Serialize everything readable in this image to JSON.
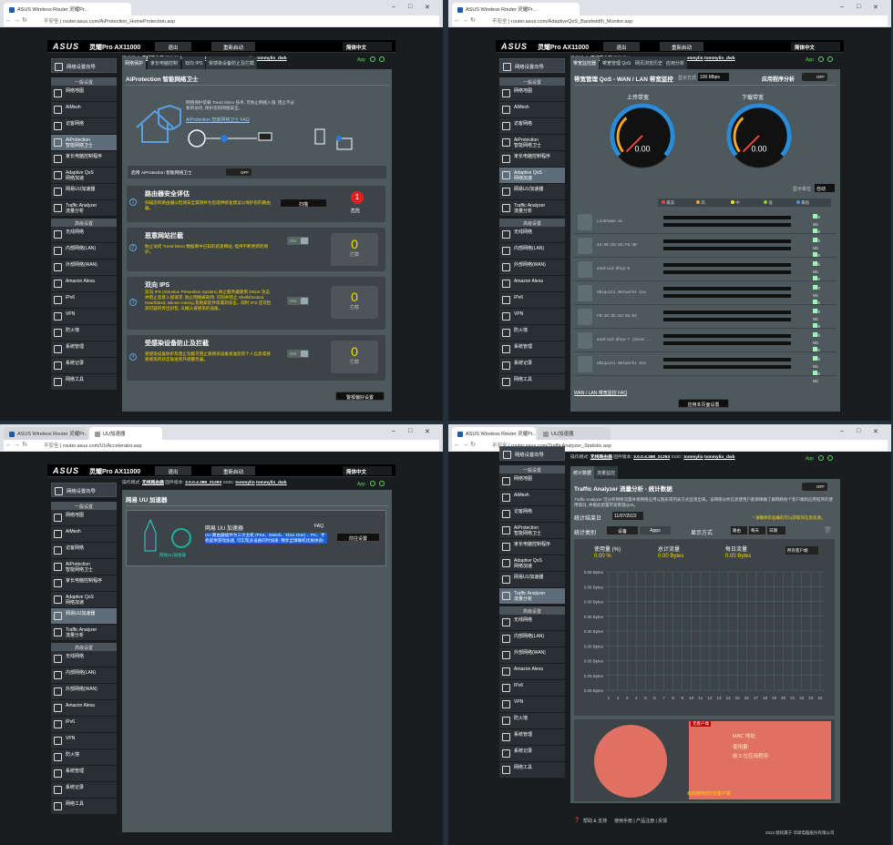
{
  "browser": {
    "tl_url": "router.asus.com/AiProtection_HomeProtection.asp",
    "tr_url": "router.asus.com/AdaptiveQoS_Bandwidth_Monitor.asp",
    "bl_url": "router.asus.com/UUAccelerator.asp",
    "br_url": "router.asus.com/TrafficAnalyzer_Statistic.asp",
    "tab_main": "ASUS Wireless Router 灵耀Pr...",
    "tab_uu": "UU加速器",
    "insecure": "不安全"
  },
  "header": {
    "logo": "ASUS",
    "model": "灵耀Pro AX11000",
    "logout": "退出",
    "reboot": "重新启动",
    "lang": "简体中文"
  },
  "info": {
    "mode_label": "操作模式:",
    "mode": "无线路由器",
    "fw_label": "固件版本:",
    "fw": "3.0.0.4.388_21293",
    "ssid_label": "SSID:",
    "ssid1": "tommylin",
    "ssid2": "tommylin_dwb",
    "app": "App"
  },
  "sidebar": {
    "qis": "网络设置向导",
    "general": "一般设置",
    "advanced": "高级设置",
    "items": [
      "网络地图",
      "AiMesh",
      "访客网络",
      "AiProtection\n智能网络卫士",
      "家长电脑控制程序",
      "Adaptive QoS\n网络加速",
      "网易UU加速器",
      "Traffic Analyzer\n流量分析"
    ],
    "adv_items": [
      "无线网络",
      "内部网络(LAN)",
      "外部网络(WAN)",
      "Amazon Alexa",
      "IPv6",
      "VPN",
      "防火墙",
      "系统管理",
      "系统记录",
      "网络工具"
    ]
  },
  "q1": {
    "tabs": [
      "网络保护",
      "家长电脑控制",
      "双向 IPS",
      "受感染设备防止及拦截"
    ],
    "title": "AiProtection 智能网络卫士",
    "intro": "网络保护搭载 Trend Micro 技术, 可防止网络入侵, 阻止不必要的访问, 保护您的网络安全。",
    "faq": "AiProtection 智能网络卫士 FAQ",
    "enable_label": "启用 AiProtection 智能网络卫士",
    "off": "OFF",
    "on": "ON",
    "cards": [
      {
        "no": "1",
        "title": "路由器安全评估",
        "desc": "扫描您的路由器以检测安全漏洞并为您提供修复建议以保护您的路由器。",
        "btn": "扫描",
        "badge": "1",
        "badge_label": "危险"
      },
      {
        "no": "2",
        "title": "恶意网站拦截",
        "desc": "防止访问 Trend Micro 数据库中已知的恶意网站, 提供不断更新的保护。",
        "count": "0",
        "count_label": "拦截"
      },
      {
        "no": "3",
        "title": "双向 IPS",
        "desc": "双向 IPS (Intrusion Prevention System) 防止服务器受到 DDoS 攻击并阻止恶意入侵请求, 防止网络被劫持, 识别并阻止 Shellshocked, Heartbleed, Bitcoin mining 及勒索软件等漏洞攻击。同时 IPS 还可检测可疑的传出封包, 以确认被感染的设备。",
        "count": "0",
        "count_label": "拦截"
      },
      {
        "no": "4",
        "title": "受感染设备防止及拦截",
        "desc": "受感染设备防护及阻止功能可阻止受感染设备发送您的个人信息或将受感染的状态发送到外部服务器。",
        "count": "0",
        "count_label": "拦截"
      }
    ],
    "alert_btn": "警报偏好设置"
  },
  "q2": {
    "tabs": [
      "带宽监控器",
      "带宽管理 QoS",
      "网页浏览历史",
      "应用分析"
    ],
    "title": "带宽管理 QoS - WAN / LAN 带宽监控",
    "display_label": "显示方式",
    "display_value": "100 Mbps",
    "app_label": "应用程序分析",
    "upload": "上传带宽",
    "download": "下载带宽",
    "up_value": "0.00",
    "down_value": "0.00",
    "unit_label": "显示单位",
    "unit_value": "自动",
    "legend": [
      "最高",
      "高",
      "中",
      "低",
      "最低"
    ],
    "legend_colors": [
      "#e8453c",
      "#f5a623",
      "#f8e71c",
      "#7ed321",
      "#4a90e2"
    ],
    "devices": [
      "Linkhome-ac",
      "44:9E:E5:84:F8:3E",
      "android-dhcp-8",
      "Ubiquiti Networks Inc",
      "F0:1D:3C:84:56:94",
      "android-dhcp-7 (Good...",
      "Ubiquiti Networks Inc"
    ],
    "rate": "0.00 Mb",
    "faq": "WAN / LAN 带宽监控 FAQ",
    "apply": "应用本页面设置"
  },
  "q3": {
    "title": "网易 UU 加速器",
    "brand": "网易UU加速器",
    "name": "网易 UU 加速器",
    "faq": "FAQ",
    "desc": "UU 路由器插件为三大主机 (PS4、Switch、Xbox One) 、PC、手机提供游戏加速, 可实现多设备同时加速, 畅享全球联机优质体验!",
    "btn": "前往设置"
  },
  "q4": {
    "tabs": [
      "统计数据",
      "流量监控"
    ],
    "title": "Traffic Analyzer 流量分析 - 统计数据",
    "intro": "Traffic Analyzer 可分析网络流量并将网络应用以图形或列表方式呈现出来。该网络分析信息使用户能够精确了解网络各个客户端和应用程序的使用情况, 并据此配置带宽管理QoS。",
    "date_label": "统计结束日",
    "date": "11/07/2022",
    "note": "* 请确保有准确的可以获取的信息资源。",
    "cat_label": "统计类别",
    "cat_dev": "设备",
    "cat_app": "Apps",
    "show_label": "显示方式",
    "show_opts": [
      "路由",
      "每天",
      "日期"
    ],
    "usage_label": "使用量 (%)",
    "total_label": "总计流量",
    "daily_label": "每日流量",
    "usage": "0.00 %",
    "total": "0.00 Bytes",
    "daily": "0.00 Bytes",
    "filter": "所有客户端",
    "y_ticks": [
      "0.00 Bytes",
      "0.00 Bytes",
      "0.00 Bytes",
      "0.00 Bytes",
      "0.00 Bytes",
      "0.00 Bytes",
      "0.00 Bytes",
      "0.00 Bytes",
      "0.00 Bytes"
    ],
    "x_ticks": [
      "1",
      "2",
      "3",
      "4",
      "5",
      "6",
      "7",
      "8",
      "9",
      "10",
      "11",
      "12",
      "13",
      "14",
      "15",
      "16",
      "17",
      "18",
      "19",
      "20",
      "21",
      "22",
      "23",
      "24"
    ],
    "badge": "无客户端",
    "mac": "MAC 地址:",
    "use": "使用量:",
    "top5": "前 5 位应用程序:",
    "top5_clients": "目前使用前5位客户端",
    "footer_help": "帮助 & 支持",
    "footer_links": "使用手册 | 产品注册 | 反馈",
    "copyright": "2022 版权属于 华硕电脑股份有限公司"
  }
}
